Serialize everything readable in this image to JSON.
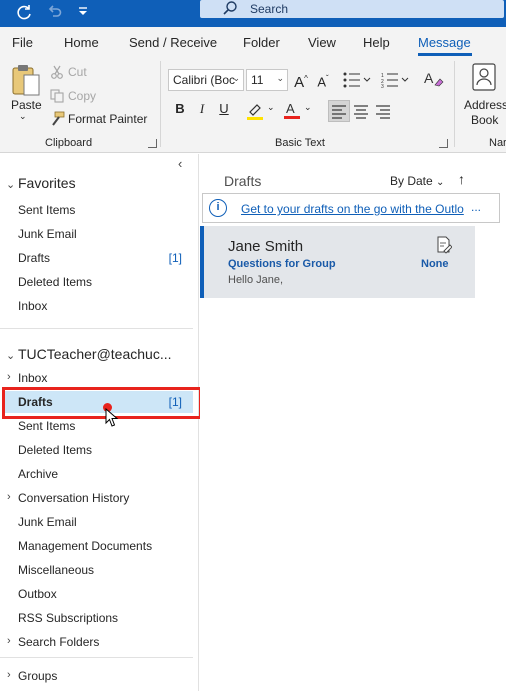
{
  "titlebar": {
    "sync_icon": "sync-icon",
    "undo_icon": "undo-icon",
    "quick_access_icon": "customize-quick-access-icon",
    "search_placeholder": "Search"
  },
  "menu": {
    "tabs": [
      "File",
      "Home",
      "Send / Receive",
      "Folder",
      "View",
      "Help",
      "Message"
    ],
    "active": "Message"
  },
  "ribbon": {
    "clipboard": {
      "label": "Clipboard",
      "paste": "Paste",
      "cut": "Cut",
      "copy": "Copy",
      "format_painter": "Format Painter"
    },
    "basic_text": {
      "label": "Basic Text",
      "font": "Calibri (Boc",
      "size": "11",
      "grow": "A^",
      "shrink": "Aˇ",
      "bold": "B",
      "italic": "I",
      "underline": "U",
      "highlight_color": "#ffe200",
      "font_color": "#e8231d"
    },
    "names": {
      "address_book_line1": "Address",
      "address_book_line2": "Book",
      "partial_label": "Nar"
    }
  },
  "nav": {
    "favorites": {
      "title": "Favorites",
      "items": [
        {
          "label": "Sent Items",
          "count": ""
        },
        {
          "label": "Junk Email",
          "count": ""
        },
        {
          "label": "Drafts",
          "count": "[1]"
        },
        {
          "label": "Deleted Items",
          "count": ""
        },
        {
          "label": "Inbox",
          "count": ""
        }
      ]
    },
    "account": {
      "title": "TUCTeacher@teachuc...",
      "items": [
        {
          "label": "Inbox",
          "count": "",
          "expandable": true
        },
        {
          "label": "Drafts",
          "count": "[1]",
          "selected": true
        },
        {
          "label": "Sent Items",
          "count": ""
        },
        {
          "label": "Deleted Items",
          "count": ""
        },
        {
          "label": "Archive",
          "count": ""
        },
        {
          "label": "Conversation History",
          "count": "",
          "expandable": true
        },
        {
          "label": "Junk Email",
          "count": ""
        },
        {
          "label": "Management Documents",
          "count": ""
        },
        {
          "label": "Miscellaneous",
          "count": ""
        },
        {
          "label": "Outbox",
          "count": ""
        },
        {
          "label": "RSS Subscriptions",
          "count": ""
        },
        {
          "label": "Search Folders",
          "count": "",
          "expandable": true
        }
      ]
    },
    "groups": "Groups"
  },
  "list": {
    "title": "Drafts",
    "sort": "By Date",
    "info_text": "Get to your drafts on the go with the Outlo",
    "info_more": "...",
    "message": {
      "from": "Jane Smith",
      "subject": "Questions for Group",
      "preview": "Hello Jane,",
      "category": "None"
    }
  },
  "colors": {
    "accent": "#0f5fb8",
    "annotation_red": "#e8231d",
    "selected_bg": "#cde6f7"
  }
}
